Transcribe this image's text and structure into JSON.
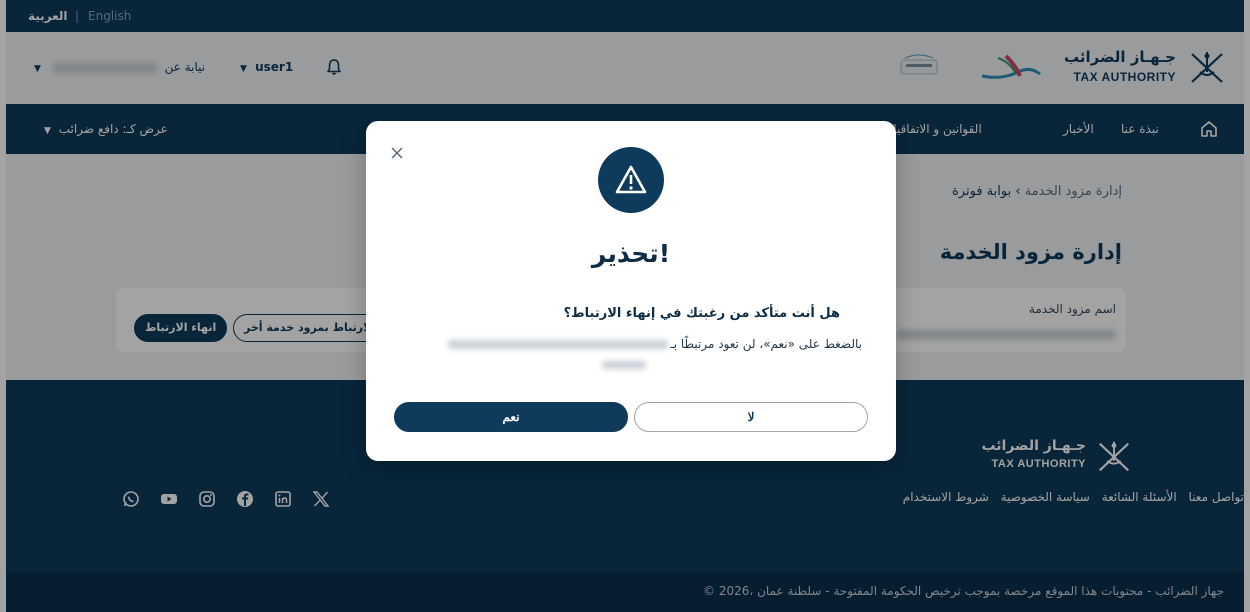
{
  "lang_bar": {
    "arabic": "العربية",
    "separator": "|",
    "english": "English"
  },
  "header": {
    "user_select": "user1",
    "rep_select_label": "نيابة عن",
    "tax_logo_ar": "جـهـاز الضرائب",
    "tax_logo_en": "TAX AUTHORITY"
  },
  "nav": {
    "items": [
      "نبذة عنا",
      "الأخبار",
      "القوانين و الاتفاقيات"
    ],
    "view_as": "عرض كـ: دافع ضرائب"
  },
  "main": {
    "breadcrumb_root": "بوابة فوترة",
    "breadcrumb_sep": "›",
    "breadcrumb_current": "إدارة مزود الخدمة",
    "page_title": "إدارة مزود الخدمة",
    "card_label": "اسم مزود الخدمة",
    "end_link_button": "انهاء الارتباط",
    "link_other_button": "الارتباط بمزود خدمة أخر"
  },
  "footer": {
    "logo_ar": "جـهـاز الضرائب",
    "logo_en": "TAX AUTHORITY",
    "links": [
      "شروط الاستخدام",
      "سياسة الخصوصية",
      "الأسئلة الشائعة",
      "تواصل معنا"
    ],
    "social_icons": [
      "whatsapp-icon",
      "youtube-icon",
      "instagram-icon",
      "facebook-icon",
      "linkedin-icon",
      "x-icon"
    ],
    "copyright": "© 2026، جهاز الضرائب - محتويات هذا الموقع مرخصة بموجب ترخيص الحكومة المفتوحة - سلطنة عمان"
  },
  "modal": {
    "title": "تحذير!",
    "question": "هل أنت متأكد من رغبتك في إنهاء الارتباط؟",
    "description": "بالضغط على «نعم»، لن تعود مرتبطًا بـ",
    "yes_label": "نعم",
    "no_label": "لا"
  },
  "colors": {
    "primary": "#0e3a5c",
    "background": "#f1f3f5"
  }
}
